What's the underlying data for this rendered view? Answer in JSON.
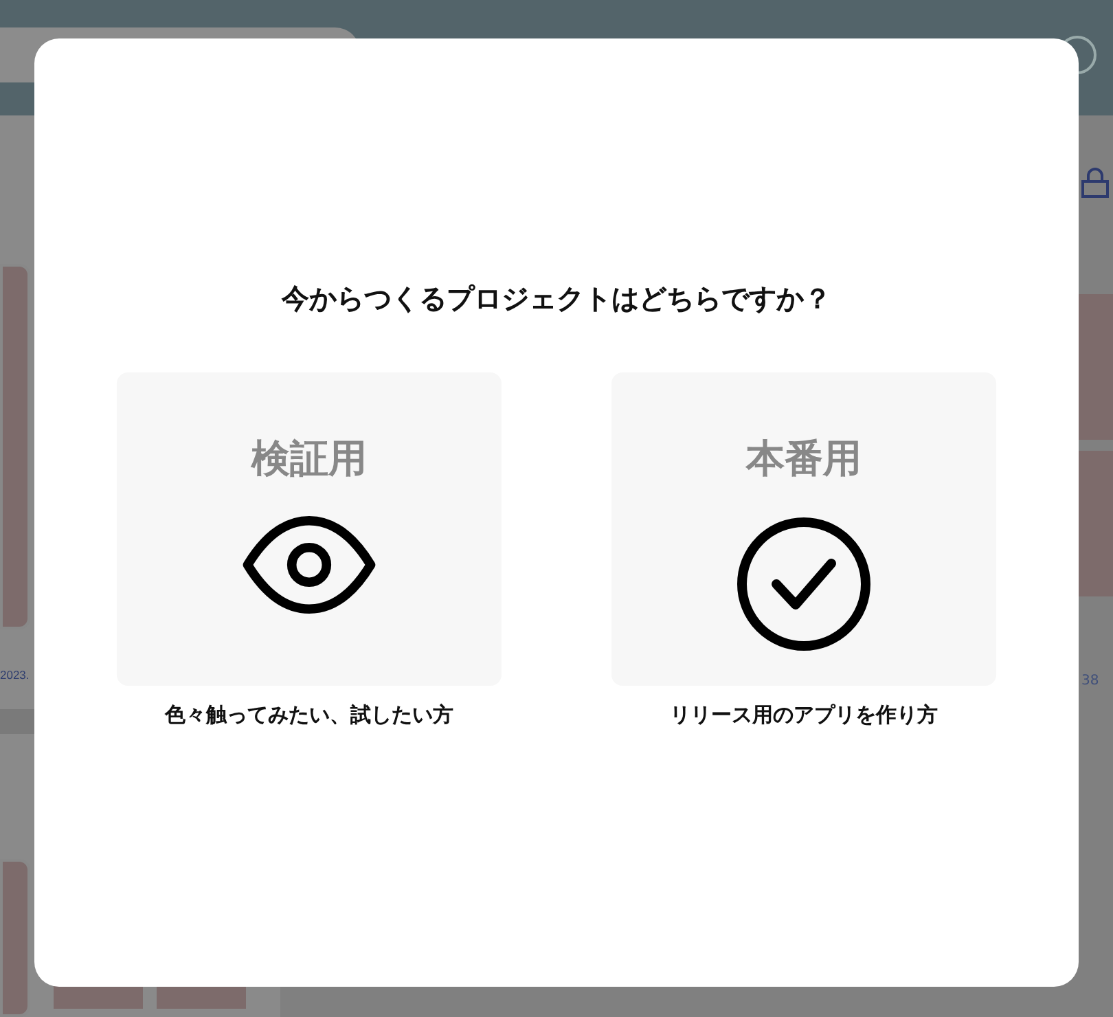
{
  "background": {
    "date_text": "2023.",
    "count_text": "38"
  },
  "dialog": {
    "title": "今からつくるプロジェクトはどちらですか？",
    "options": [
      {
        "label": "検証用",
        "kind": "eye",
        "caption": "色々触ってみたい、試したい方"
      },
      {
        "label": "本番用",
        "kind": "check",
        "caption": "リリース用のアプリを作り方"
      }
    ]
  }
}
